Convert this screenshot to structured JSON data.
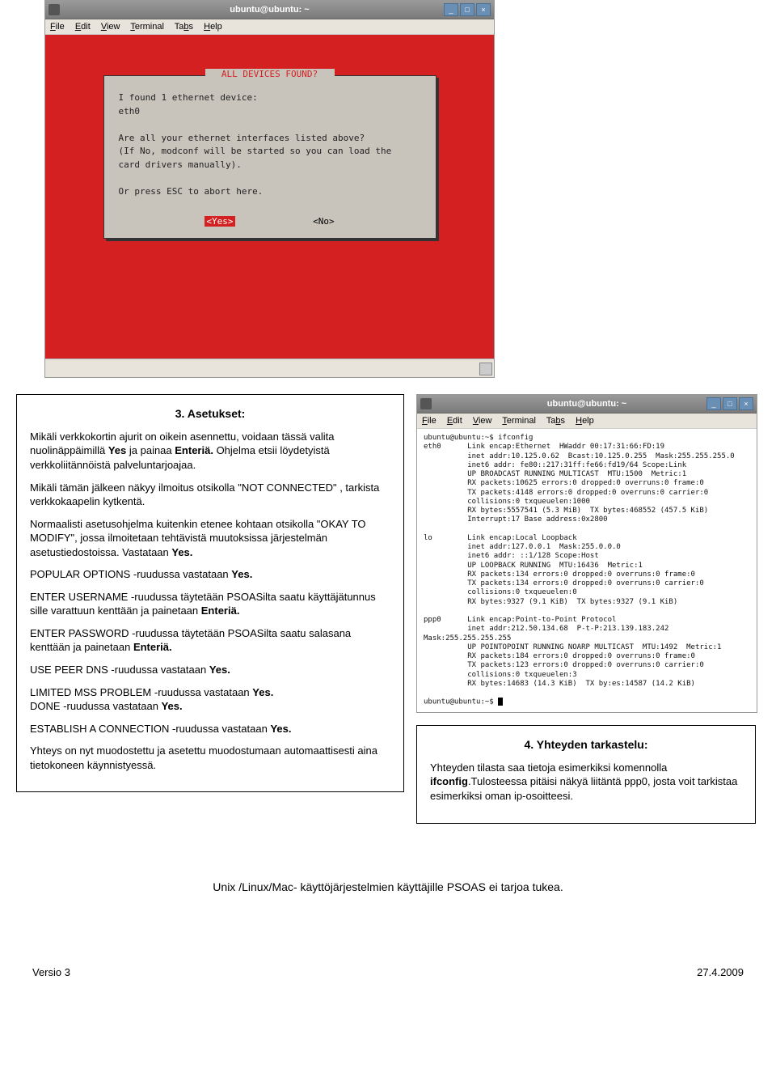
{
  "screenshot1": {
    "title": "ubuntu@ubuntu: ~",
    "menu": {
      "file": "File",
      "edit": "Edit",
      "view": "View",
      "terminal": "Terminal",
      "tabs": "Tabs",
      "help": "Help"
    },
    "dialog": {
      "title": "ALL DEVICES FOUND?",
      "line1": "I found 1 ethernet device:",
      "line2": "eth0",
      "line3": "Are all your ethernet interfaces listed above?",
      "line4": "(If No, modconf will be started so you can load the",
      "line5": "card drivers manually).",
      "line6": "Or press ESC to abort here.",
      "yes": "<Yes>",
      "no": "<No>"
    }
  },
  "box3": {
    "heading": "3. Asetukset:",
    "p1a": "Mikäli verkkokortin ajurit on oikein asennettu, voidaan tässä valita nuolinäppäimillä ",
    "p1b": "Yes",
    "p1c": " ja painaa ",
    "p1d": "Enteriä.",
    "p1e": " Ohjelma etsii löydetyistä verkkoliitännöistä palveluntarjoajaa.",
    "p2": "Mikäli tämän jälkeen näkyy ilmoitus otsikolla \"NOT CONNECTED\" , tarkista verkkokaapelin kytkentä.",
    "p3a": "Normaalisti asetusohjelma kuitenkin etenee kohtaan otsikolla \"OKAY TO MODIFY\", jossa ilmoitetaan tehtävistä muutoksissa järjestelmän asetustiedostoissa. Vastataan ",
    "p3b": "Yes.",
    "p4a": "POPULAR OPTIONS -ruudussa vastataan ",
    "p4b": "Yes.",
    "p5a": "ENTER USERNAME -ruudussa täytetään PSOASilta saatu käyttäjätunnus sille varattuun kenttään ja painetaan ",
    "p5b": "Enteriä.",
    "p6a": "ENTER PASSWORD -ruudussa täytetään PSOASilta saatu salasana kenttään ja painetaan ",
    "p6b": "Enteriä.",
    "p7a": "USE PEER DNS -ruudussa vastataan ",
    "p7b": "Yes.",
    "p8a": "LIMITED MSS PROBLEM -ruudussa vastataan ",
    "p8b": "Yes.",
    "p8c": " DONE -ruudussa vastataan ",
    "p8d": "Yes.",
    "p9a": "ESTABLISH A CONNECTION -ruudussa vastataan ",
    "p9b": "Yes.",
    "p10": "Yhteys on nyt muodostettu ja asetettu muodostumaan automaattisesti aina tietokoneen käynnistyessä."
  },
  "screenshot2": {
    "title": "ubuntu@ubuntu: ~",
    "output": "ubuntu@ubuntu:~$ ifconfig\neth0      Link encap:Ethernet  HWaddr 00:17:31:66:FD:19\n          inet addr:10.125.0.62  Bcast:10.125.0.255  Mask:255.255.255.0\n          inet6 addr: fe80::217:31ff:fe66:fd19/64 Scope:Link\n          UP BROADCAST RUNNING MULTICAST  MTU:1500  Metric:1\n          RX packets:10625 errors:0 dropped:0 overruns:0 frame:0\n          TX packets:4148 errors:0 dropped:0 overruns:0 carrier:0\n          collisions:0 txqueuelen:1000\n          RX bytes:5557541 (5.3 MiB)  TX bytes:468552 (457.5 KiB)\n          Interrupt:17 Base address:0x2800\n\nlo        Link encap:Local Loopback\n          inet addr:127.0.0.1  Mask:255.0.0.0\n          inet6 addr: ::1/128 Scope:Host\n          UP LOOPBACK RUNNING  MTU:16436  Metric:1\n          RX packets:134 errors:0 dropped:0 overruns:0 frame:0\n          TX packets:134 errors:0 dropped:0 overruns:0 carrier:0\n          collisions:0 txqueuelen:0\n          RX bytes:9327 (9.1 KiB)  TX bytes:9327 (9.1 KiB)\n\nppp0      Link encap:Point-to-Point Protocol\n          inet addr:212.50.134.68  P-t-P:213.139.183.242  Mask:255.255.255.255\n          UP POINTOPOINT RUNNING NOARP MULTICAST  MTU:1492  Metric:1\n          RX packets:184 errors:0 dropped:0 overruns:0 frame:0\n          TX packets:123 errors:0 dropped:0 overruns:0 carrier:0\n          collisions:0 txqueuelen:3\n          RX bytes:14683 (14.3 KiB)  TX by:es:14587 (14.2 KiB)\n\nubuntu@ubuntu:~$ "
  },
  "box4": {
    "heading": "4. Yhteyden tarkastelu:",
    "p1a": "Yhteyden tilasta saa tietoja esimerkiksi komennolla ",
    "p1b": "ifconfig",
    "p1c": ".Tulosteessa pitäisi näkyä liitäntä ppp0, josta voit tarkistaa esimerkiksi oman ip-osoitteesi."
  },
  "footerText": "Unix /Linux/Mac- käyttöjärjestelmien käyttäjille PSOAS ei tarjoa tukea.",
  "footer": {
    "version": "Versio 3",
    "date": "27.4.2009"
  }
}
